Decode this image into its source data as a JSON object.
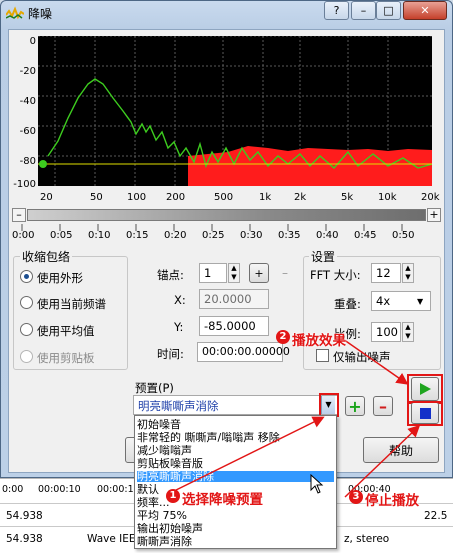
{
  "window": {
    "title": "降噪"
  },
  "window_buttons": {
    "help": "?",
    "minimize": "–",
    "maximize": "□",
    "close": "✕"
  },
  "spectrum": {
    "y_ticks": [
      "0",
      "-20",
      "-40",
      "-60",
      "-80",
      "-100"
    ],
    "x_ticks": [
      "20",
      "50",
      "100",
      "200",
      "500",
      "1k",
      "2k",
      "5k",
      "10k",
      "20k"
    ]
  },
  "timeline": {
    "minus": "–",
    "plus": "+",
    "ticks": [
      "0:00",
      "0:05",
      "0:10",
      "0:15",
      "0:20",
      "0:25",
      "0:30",
      "0:35",
      "0:40",
      "0:45",
      "0:50"
    ]
  },
  "shrink_envelope": {
    "title": "收缩包络",
    "options": [
      {
        "label": "使用外形",
        "selected": true,
        "enabled": true
      },
      {
        "label": "使用当前频谱",
        "selected": false,
        "enabled": true
      },
      {
        "label": "使用平均值",
        "selected": false,
        "enabled": true
      },
      {
        "label": "使用剪贴板",
        "selected": false,
        "enabled": false
      }
    ]
  },
  "anchor": {
    "anchor_label": "锚点:",
    "anchor_value": "1",
    "x_label": "X:",
    "x_value": "20.0000",
    "y_label": "Y:",
    "y_value": "-85.0000",
    "time_label": "时间:",
    "time_value": "00:00:00.00000"
  },
  "settings": {
    "title": "设置",
    "fft_label": "FFT 大小:",
    "fft_value": "12",
    "overlap_label": "重叠:",
    "overlap_value": "4x",
    "reduction_label": "比例:",
    "reduction_value": "100",
    "output_noise_label": "仅输出噪声"
  },
  "preset": {
    "label": "预置(P)",
    "current_value": "明亮嘶嘶声消除",
    "add": "+",
    "remove": "–",
    "options": [
      "初始噪音",
      "非常轻的 嘶嘶声/嗡嗡声 移除",
      "减少嗡嗡声",
      "剪贴板噪音版",
      "明亮嘶嘶声消除",
      "默认",
      "频率...",
      "平均 75%",
      "输出初始噪声",
      "嘶嘶声消除"
    ],
    "selected_index": 4
  },
  "buttons": {
    "ok": "确定",
    "help": "帮助"
  },
  "annotations": {
    "step1": {
      "num": "1",
      "text": "选择降噪预置"
    },
    "step2": {
      "num": "2",
      "text": "播放效果"
    },
    "step3": {
      "num": "3",
      "text": "停止播放"
    }
  },
  "bottom": {
    "ruler": [
      "0:00",
      "00:00:10",
      "00:00:15",
      "00:00:20",
      "00:00:25",
      "00:00:30",
      "00:00:35",
      "00:00:40"
    ],
    "row1_left": "54.938",
    "row1_right": "22.5",
    "row2_left": "54.938",
    "row2_mid": "Wave IEE",
    "row2_right": "z, stereo"
  },
  "colors": {
    "accent_red": "#e21616",
    "curve_green": "#3dcc1f",
    "noise_red": "#ff1c1c",
    "selection_blue": "#3399ff"
  }
}
